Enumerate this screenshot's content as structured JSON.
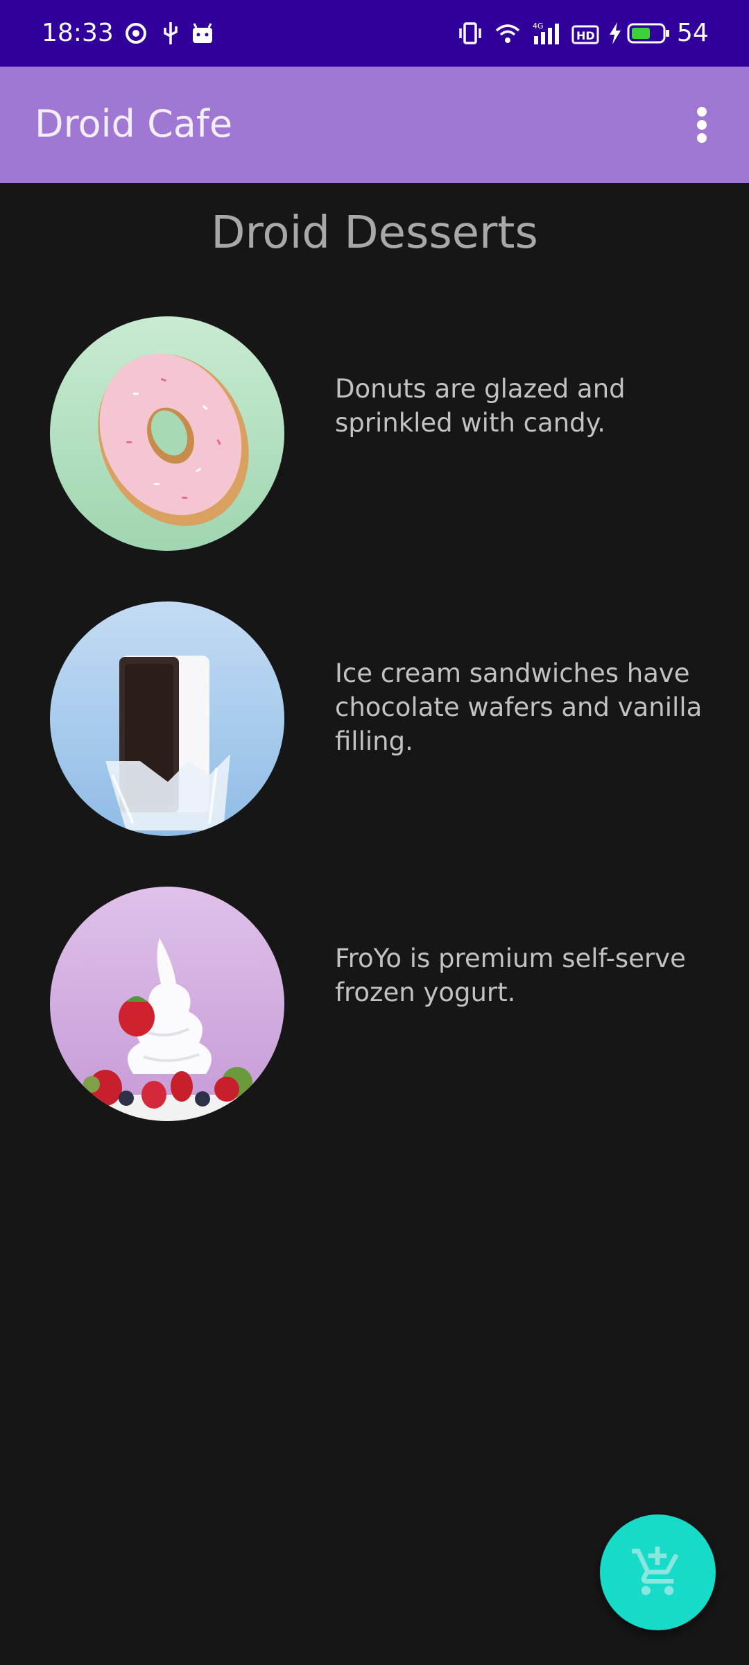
{
  "status_bar": {
    "time": "18:33",
    "battery": "54",
    "icons": [
      "hotspot-icon",
      "usb-icon",
      "android-icon",
      "vibrate-icon",
      "wifi-icon",
      "signal-4g-icon",
      "hd-icon",
      "charging-icon",
      "battery-icon"
    ]
  },
  "app_bar": {
    "title": "Droid Cafe",
    "menu_icon": "more-vert-icon"
  },
  "page": {
    "heading": "Droid Desserts"
  },
  "desserts": [
    {
      "image": "donut",
      "description": "Donuts are glazed and sprinkled with candy."
    },
    {
      "image": "ice-cream-sandwich",
      "description": "Ice cream sandwiches have chocolate wafers and vanilla filling."
    },
    {
      "image": "froyo",
      "description": "FroYo is premium self-serve frozen yogurt."
    }
  ],
  "fab": {
    "icon": "add-shopping-cart-icon"
  },
  "colors": {
    "status_bar": "#31009a",
    "app_bar": "#a177d4",
    "background": "#161617",
    "fab": "#17dbc9"
  }
}
